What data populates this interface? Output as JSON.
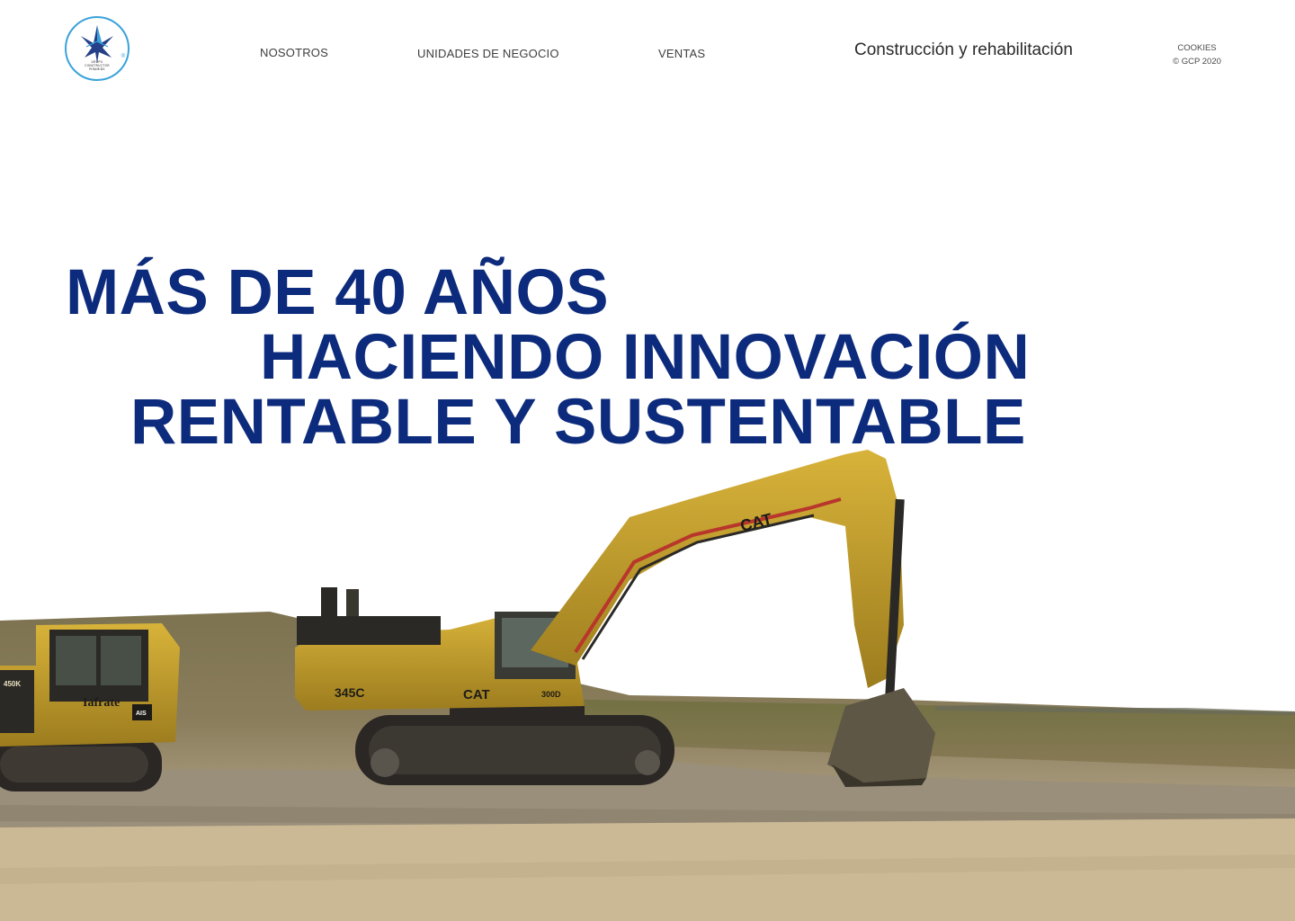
{
  "header": {
    "logo": {
      "icon": "pyramid-star-logo-icon",
      "line1": "GRUPO",
      "line2": "CONSTRUCTOR",
      "line3": "PIRAMIDE",
      "registered": "®"
    },
    "nav": {
      "nosotros": "NOSOTROS",
      "unidades": "UNIDADES DE NEGOCIO",
      "ventas": "VENTAS",
      "feature": "Construcción y rehabilitación"
    },
    "footer": {
      "cookies": "COOKIES",
      "copyright": "© GCP 2020"
    }
  },
  "hero": {
    "headline_line1": "MÁS DE 40 AÑOS",
    "headline_line2": "HACIENDO INNOVACIÓN",
    "headline_line3": "RENTABLE Y SUSTENTABLE",
    "photo": {
      "excavator_brand": "CAT",
      "excavator_model": "345C",
      "excavator_series": "300D",
      "dozer_brand": "Iafrate",
      "dozer_model": "450K",
      "dozer_badge": "AIS"
    }
  },
  "colors": {
    "headline": "#0d2b7c",
    "logo_ring": "#3aa2db",
    "machine_yellow": "#c9a227"
  }
}
